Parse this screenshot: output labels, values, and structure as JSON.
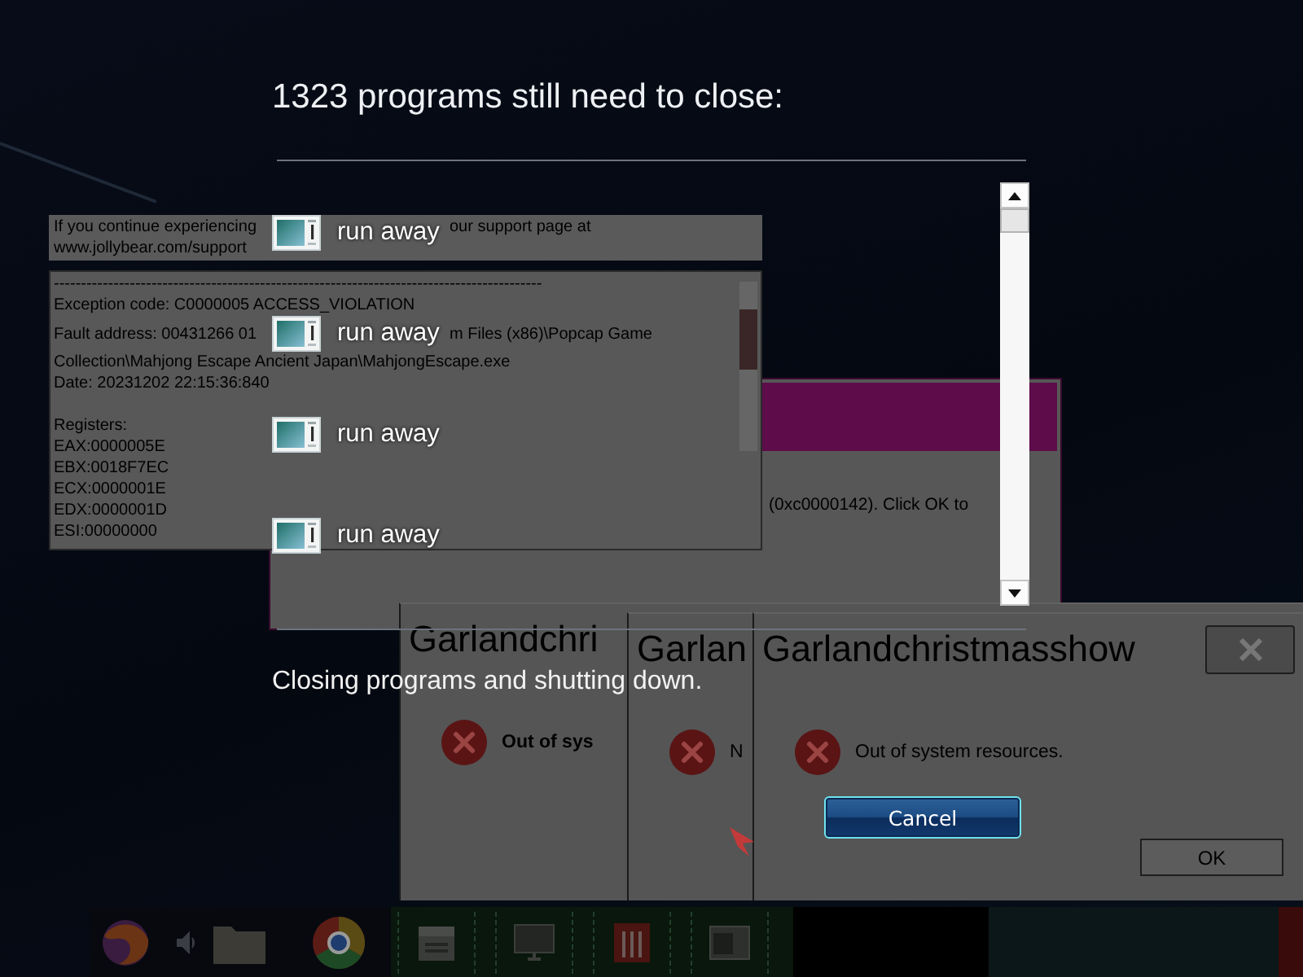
{
  "crash_report": {
    "notice_lines": [
      {
        "parts": [
          "If you continue experiencing",
          "our support page at"
        ]
      },
      {
        "parts": [
          "www.jollybear.com/support"
        ]
      }
    ],
    "report_sections": [
      {
        "lines": [
          {
            "parts": [
              "------------------------------------------------------------------------------------------"
            ]
          },
          {
            "parts": [
              "Exception code: C0000005 ACCESS_VIOLATION"
            ]
          },
          {
            "parts": [
              "Fault address: 00431266 01",
              "m Files (x86)\\Popcap Game"
            ]
          },
          {
            "parts": [
              "Collection\\Mahjong Escape Ancient Japan\\MahjongEscape.exe"
            ]
          },
          {
            "parts": [
              "Date: 20231202 22:15:36:840"
            ]
          }
        ]
      },
      {
        "lines": [
          {
            "parts": [
              "Registers:"
            ]
          },
          {
            "parts": [
              "EAX:0000005E"
            ]
          },
          {
            "parts": [
              "EBX:0018F7EC"
            ]
          },
          {
            "parts": [
              "ECX:0000001E"
            ]
          },
          {
            "parts": [
              "EDX:0000001D"
            ]
          },
          {
            "parts": [
              "ESI:00000000"
            ]
          }
        ]
      }
    ]
  },
  "error_dialog": {
    "message": "(0xc0000142). Click OK to"
  },
  "message_boxes": [
    {
      "title": "Garlandchri",
      "message": "Out of sys"
    },
    {
      "title": "Garlan",
      "message": "N"
    },
    {
      "title": "Garlandchristmasshow",
      "message": "Out of system resources.",
      "button": "OK"
    }
  ],
  "shutdown": {
    "title": "1323 programs still need to close:",
    "programs": [
      {
        "name": "run away"
      },
      {
        "name": "run away"
      },
      {
        "name": "run away"
      },
      {
        "name": "run away"
      }
    ],
    "status": "Closing programs and shutting down.",
    "button": "Cancel"
  }
}
